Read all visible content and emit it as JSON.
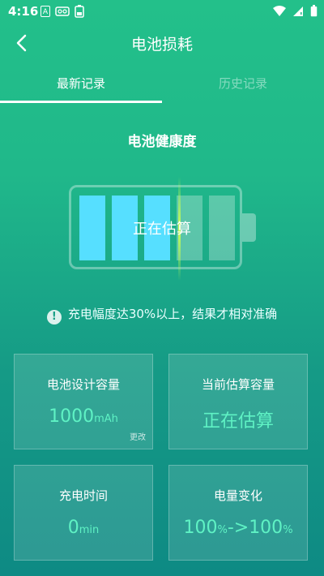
{
  "status_bar": {
    "time": "4:16",
    "left_icons": [
      "a-notification-icon",
      "voicemail-icon",
      "battery-saver-icon"
    ],
    "right_icons": [
      "wifi-icon",
      "cellular-signal-icon",
      "battery-icon"
    ]
  },
  "header": {
    "title": "电池损耗"
  },
  "tabs": [
    {
      "label": "最新记录",
      "active": true
    },
    {
      "label": "历史记录",
      "active": false
    }
  ],
  "battery_health": {
    "title": "电池健康度",
    "status_text": "正在估算",
    "cells_filled": 3,
    "cells_total": 5
  },
  "notice": {
    "icon": "!",
    "text": "充电幅度达30%以上，结果才相对准确"
  },
  "cards": {
    "design_capacity": {
      "title": "电池设计容量",
      "value": "1000",
      "unit": "mAh",
      "edit_label": "更改"
    },
    "estimated_capacity": {
      "title": "当前估算容量",
      "value": "正在估算"
    },
    "charge_time": {
      "title": "充电时间",
      "value": "0",
      "unit": "min"
    },
    "level_change": {
      "title": "电量变化",
      "from": "100",
      "unit1": "%",
      "arrow": "->",
      "to": "100",
      "unit2": "%"
    }
  },
  "colors": {
    "accent_cell": "#56dfff",
    "value_text": "#5ff2c4"
  }
}
